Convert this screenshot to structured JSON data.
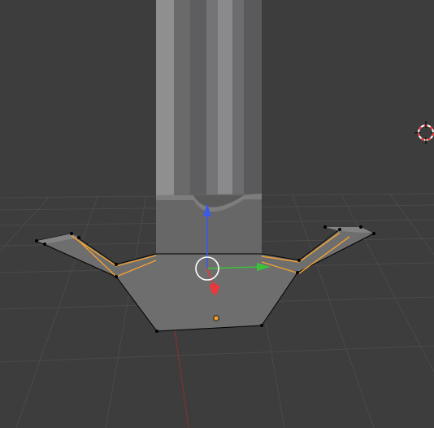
{
  "viewport": {
    "mode": "edit-mode",
    "background_color": "#3d3d3d",
    "grid_color": "#4a4a4a",
    "object": "sword-blade-with-crossguard",
    "selected_edges_color": "#f0a030",
    "vertex_color": "#000000"
  },
  "gizmo": {
    "type": "translate-manipulator",
    "x_axis_color": "#e8383d",
    "y_axis_color": "#3ac23a",
    "z_axis_color": "#3a5ae8",
    "center_circle_color": "#ffffff"
  },
  "cursor_3d": {
    "icon": "3d-cursor-icon",
    "ring_colors": [
      "#ff3333",
      "#ffffff"
    ]
  },
  "origin_point": {
    "icon": "object-origin-icon",
    "color": "#f0a030"
  }
}
